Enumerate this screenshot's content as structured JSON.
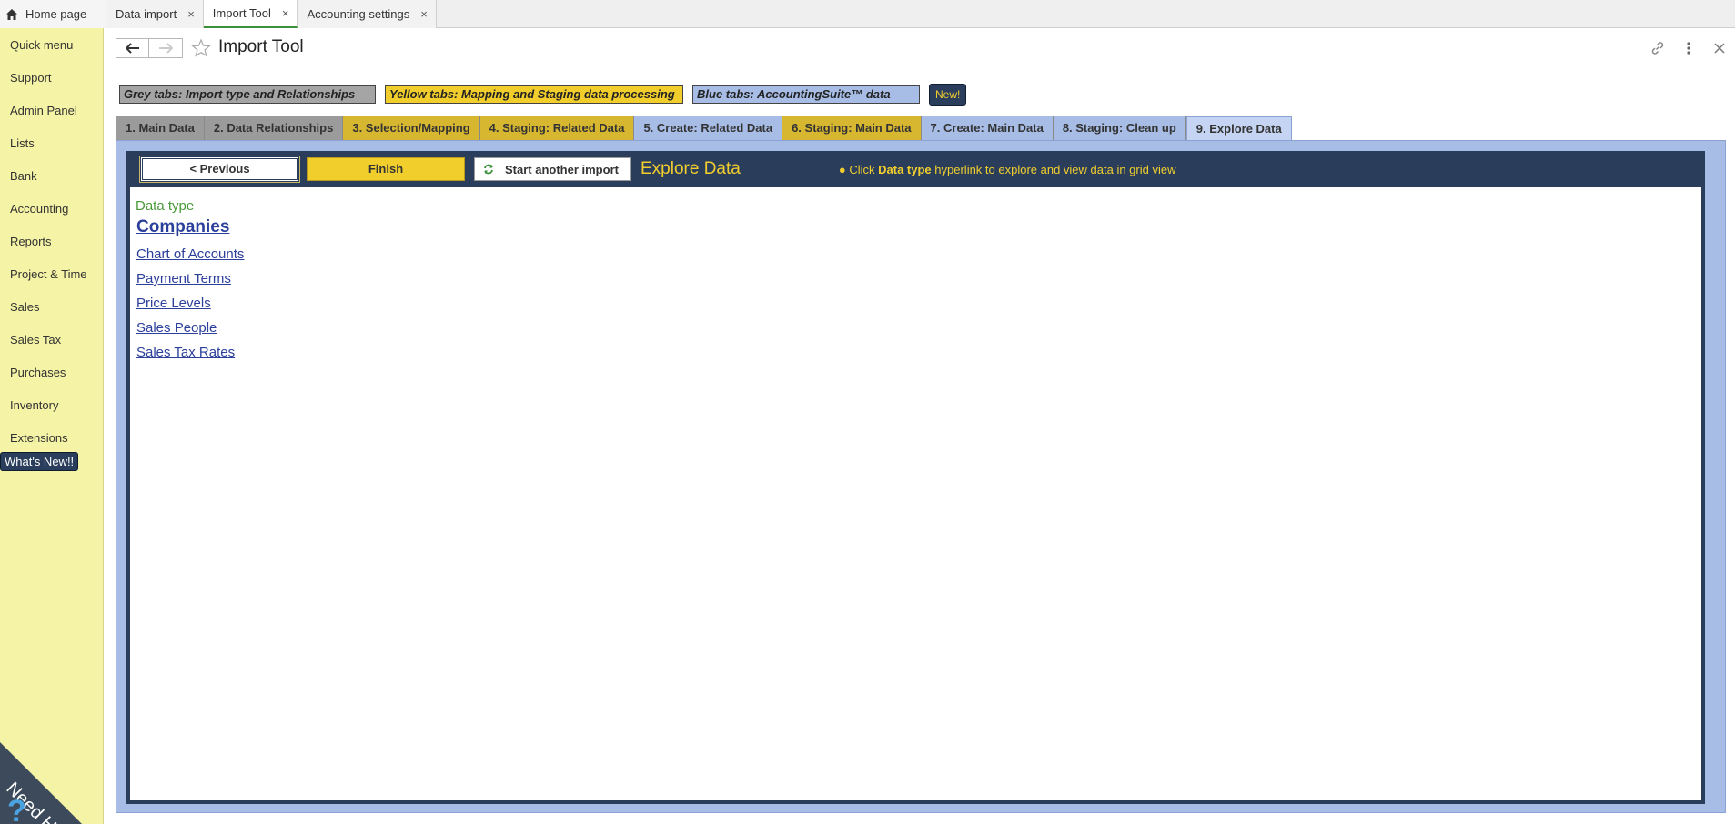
{
  "tabs": {
    "home": "Home page",
    "items": [
      {
        "label": "Data import",
        "close": "×"
      },
      {
        "label": "Import Tool",
        "close": "×"
      },
      {
        "label": "Accounting settings",
        "close": "×"
      }
    ]
  },
  "sidebar": {
    "items": [
      "Quick menu",
      "Support",
      "Admin Panel",
      "Lists",
      "Bank",
      "Accounting",
      "Reports",
      "Project & Time",
      "Sales",
      "Sales Tax",
      "Purchases",
      "Inventory",
      "Extensions"
    ],
    "whats_new": "What's New!!",
    "need_help": "Need Help"
  },
  "header": {
    "title": "Import Tool"
  },
  "legend": {
    "grey": "Grey tabs: Import type and Relationships",
    "yellow": "Yellow tabs: Mapping and Staging data processing",
    "blue": "Blue tabs: AccountingSuite™ data",
    "new": "New!"
  },
  "steps": [
    {
      "label": "1. Main Data",
      "color": "grey"
    },
    {
      "label": "2. Data Relationships",
      "color": "grey"
    },
    {
      "label": "3. Selection/Mapping",
      "color": "yellow"
    },
    {
      "label": "4. Staging: Related Data",
      "color": "yellow"
    },
    {
      "label": "5. Create: Related Data",
      "color": "blue"
    },
    {
      "label": "6. Staging: Main Data",
      "color": "yellow"
    },
    {
      "label": "7. Create: Main Data",
      "color": "blue"
    },
    {
      "label": "8. Staging: Clean up",
      "color": "blue"
    },
    {
      "label": "9. Explore Data",
      "color": "blue",
      "active": true
    }
  ],
  "toolbar": {
    "previous": "< Previous",
    "finish": "Finish",
    "start_another": "Start another import",
    "title": "Explore Data",
    "hint_bullet": "●",
    "hint_pre": "Click",
    "hint_bold": "Data type",
    "hint_post": "hyperlink to explore and view data in grid view"
  },
  "content": {
    "label": "Data type",
    "links": [
      "Companies",
      "Chart of Accounts",
      "Payment Terms",
      "Price Levels",
      "Sales People",
      "Sales Tax Rates"
    ]
  }
}
